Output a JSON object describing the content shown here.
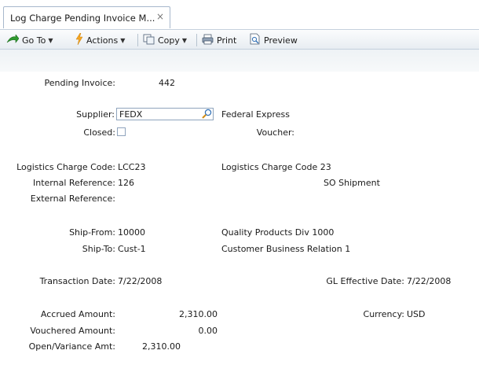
{
  "tab": {
    "title": "Log Charge Pending Invoice M...",
    "close": "×"
  },
  "toolbar": {
    "goto": "Go To",
    "actions": "Actions",
    "copy": "Copy",
    "print": "Print",
    "preview": "Preview"
  },
  "form": {
    "pending_invoice_label": "Pending Invoice:",
    "pending_invoice_value": "442",
    "supplier_label": "Supplier:",
    "supplier_value": "FEDX",
    "supplier_name": "Federal Express",
    "closed_label": "Closed:",
    "voucher_label": "Voucher:",
    "lcc_label": "Logistics Charge Code:",
    "lcc_value": "LCC23",
    "lcc_desc": "Logistics Charge Code 23",
    "internal_ref_label": "Internal Reference:",
    "internal_ref_value": "126",
    "internal_ref_desc": "SO Shipment",
    "external_ref_label": "External Reference:",
    "ship_from_label": "Ship-From:",
    "ship_from_value": "10000",
    "ship_from_desc": "Quality Products Div 1000",
    "ship_to_label": "Ship-To:",
    "ship_to_value": "Cust-1",
    "ship_to_desc": "Customer Business Relation 1",
    "transaction_date_label": "Transaction Date:",
    "transaction_date_value": "7/22/2008",
    "gl_date_label": "GL Effective Date:",
    "gl_date_value": "7/22/2008",
    "accrued_label": "Accrued Amount:",
    "accrued_value": "2,310.00",
    "currency_label": "Currency:",
    "currency_value": "USD",
    "vouchered_label": "Vouchered Amount:",
    "vouchered_value": "0.00",
    "open_label": "Open/Variance Amt:",
    "open_value": "2,310.00"
  },
  "colors": {
    "accent_border": "#a7b8cc",
    "toolbar_bg": "#e8edf2"
  }
}
